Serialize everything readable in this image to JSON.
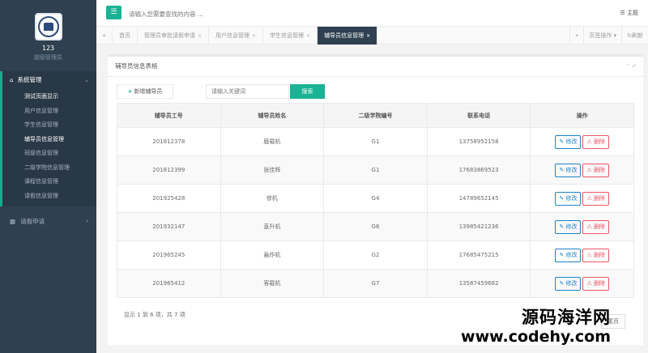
{
  "sidebar": {
    "user_name": "123",
    "user_role": "超级管理员",
    "menu_system": "系统管理",
    "items": [
      {
        "label": "测试页面显示"
      },
      {
        "label": "用户信息管理"
      },
      {
        "label": "学生信息管理"
      },
      {
        "label": "辅导员信息管理"
      },
      {
        "label": "班级信息管理"
      },
      {
        "label": "二级学院信息管理"
      },
      {
        "label": "课程信息管理"
      },
      {
        "label": "请假信息管理"
      }
    ],
    "menu_leave": "请假申请"
  },
  "topbar": {
    "menu_icon": "menu-icon",
    "search_placeholder": "请输入您需要查找的内容 ...",
    "theme_label": "主题"
  },
  "tabs": {
    "items": [
      {
        "label": "首页",
        "closable": false
      },
      {
        "label": "管理员审批请假申请",
        "closable": true
      },
      {
        "label": "用户信息管理",
        "closable": true
      },
      {
        "label": "学生信息管理",
        "closable": true
      },
      {
        "label": "辅导员信息管理",
        "closable": true,
        "active": true
      }
    ],
    "page_ops": "页签操作",
    "refresh": "刷新"
  },
  "panel": {
    "title": "辅导员信息表格",
    "add_label": "新增辅导员",
    "keyword_placeholder": "请输入关键词",
    "search_label": "搜索"
  },
  "table": {
    "headers": [
      "辅导员工号",
      "辅导员姓名",
      "二级学院编号",
      "联系电话",
      "操作"
    ],
    "rows": [
      [
        "201812378",
        "膜载机",
        "G1",
        "13758952158"
      ],
      [
        "201812399",
        "张佳辉",
        "G1",
        "17683869523"
      ],
      [
        "201925428",
        "慘机",
        "G4",
        "14789652145"
      ],
      [
        "201932147",
        "直升机",
        "G6",
        "13985421236"
      ],
      [
        "201965245",
        "轰炸机",
        "G2",
        "17685475215"
      ],
      [
        "201965412",
        "客载机",
        "G7",
        "13587459682"
      ]
    ],
    "edit_label": "修改",
    "delete_label": "删除"
  },
  "pager": {
    "summary": "显示 1 到 6 项，共 7 项",
    "last_label": "尾页"
  },
  "watermark": {
    "line1": "源码海洋网",
    "line2": "www.codehy.com"
  },
  "colors": {
    "sidebar_bg": "#2f4050",
    "accent": "#1ab394",
    "edit": "#1c84c6",
    "delete": "#ed5565"
  }
}
